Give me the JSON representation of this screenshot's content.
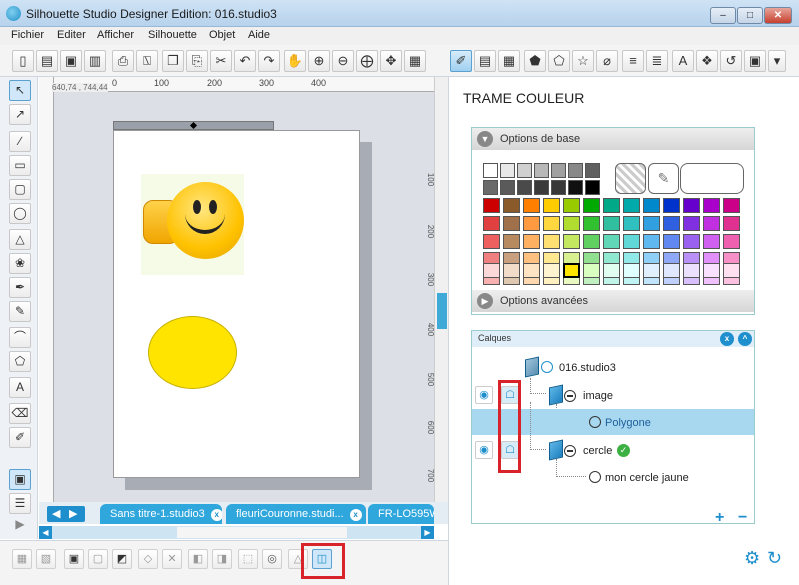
{
  "window": {
    "title": "Silhouette Studio Designer Edition: 016.studio3",
    "minimize": "–",
    "maximize": "□",
    "close": "✕"
  },
  "menu": [
    "Fichier",
    "Editer",
    "Afficher",
    "Silhouette",
    "Objet",
    "Aide"
  ],
  "toolbar": {
    "left_icons": [
      "new-doc-icon",
      "open-folder-icon",
      "save-icon",
      "save-as-icon",
      "print-icon",
      "cut-settings-icon",
      "copy-icon",
      "paste-icon",
      "scissors-icon",
      "undo-icon",
      "redo-icon",
      "pan-hand-icon",
      "zoom-in-icon",
      "zoom-out-icon",
      "zoom-select-icon",
      "zoom-drag-icon",
      "fit-page-icon"
    ],
    "left_glyphs": [
      "▯",
      "▤",
      "▣",
      "▥",
      "⎙",
      "⍂",
      "❐",
      "⎘",
      "✂",
      "↶",
      "↷",
      "✋",
      "⊕",
      "⊖",
      "⨁",
      "✥",
      "▦"
    ],
    "right_glyphs": [
      "✐",
      "▤",
      "▦",
      "⬟",
      "⬠",
      "☆",
      "⌀",
      "≡",
      "≣",
      "A",
      "❖",
      "↺",
      "▣",
      "▾"
    ]
  },
  "left_tools": [
    "↖",
    "↗",
    "∕",
    "▭",
    "▢",
    "◯",
    "△",
    "❀",
    "✒",
    "✎",
    "⌒",
    "⬠",
    "A",
    "⌫",
    "✐",
    "▣",
    "☰",
    "▶"
  ],
  "canvas": {
    "coordinates": "640,74 , 744,44",
    "ruler_top": [
      "0",
      "100",
      "200",
      "300",
      "400"
    ],
    "ruler_side": [
      "100",
      "200",
      "300",
      "400",
      "500",
      "600",
      "700"
    ]
  },
  "tabs": [
    {
      "label": "Sans titre-1.studio3",
      "close": "x"
    },
    {
      "label": "fleuriCouronne.studi...",
      "close": "x"
    },
    {
      "label": "FR-LO595W",
      "close": ""
    }
  ],
  "tab_nav": {
    "prev": "◀",
    "next": "▶"
  },
  "bottom_icons": [
    "group-icon",
    "ungroup-icon",
    "compound-icon",
    "release-compound-icon",
    "weld-icon",
    "delete-icon",
    "bring-front-icon",
    "send-back-icon",
    "offset-icon",
    "trace-icon",
    "replicate-icon",
    "layers-icon"
  ],
  "panel": {
    "title": "TRAME COULEUR",
    "basic_options": "Options de base",
    "advanced_options": "Options avancées",
    "collapse_glyph": "▼",
    "expand_glyph": "▶"
  },
  "palette": {
    "grays": [
      "#ffffff",
      "#e8e8e8",
      "#d0d0d0",
      "#b8b8b8",
      "#a0a0a0",
      "#888888",
      "#606060",
      "#383838",
      "#101010",
      "#000000"
    ],
    "rows": [
      [
        "#cc0000",
        "#8b5a2b",
        "#ff8000",
        "#ffcc00",
        "#99cc00",
        "#00aa00",
        "#00aa88",
        "#00aaaa",
        "#0088cc",
        "#0033cc",
        "#6600cc",
        "#aa00cc",
        "#cc0088"
      ],
      [
        "#e04040",
        "#a0704a",
        "#ff9a40",
        "#ffd840",
        "#b0dd30",
        "#30c030",
        "#30c0a0",
        "#30c0c0",
        "#30a0e0",
        "#3060e0",
        "#8030e0",
        "#c030e0",
        "#e03090"
      ],
      [
        "#ee6060",
        "#b88a60",
        "#ffb060",
        "#ffe070",
        "#c4e860",
        "#60d060",
        "#60d8b8",
        "#60d8d8",
        "#60b8f0",
        "#6088f0",
        "#9a60f0",
        "#d060f0",
        "#f060b0"
      ],
      [
        "#f08080",
        "#c8a080",
        "#ffc080",
        "#ffe890",
        "#d8f090",
        "#90e090",
        "#90e8d0",
        "#90e8e8",
        "#90d0f8",
        "#90a8f8",
        "#b890f8",
        "#e090f8",
        "#f890c8"
      ],
      [
        "#f8b0b0",
        "#e0c8b0",
        "#ffd8b0",
        "#fff0c0",
        "#e8f8c0",
        "#c0f0c0",
        "#c0f4e8",
        "#c0f4f4",
        "#c0e4fc",
        "#c0d0fc",
        "#d8c0fc",
        "#f0c0fc",
        "#fcc0e0"
      ]
    ],
    "selected_color": "#ffe400",
    "picker_glyph": "✎"
  },
  "layers": {
    "header": "Calques",
    "close_glyph": "x",
    "up_glyph": "^",
    "root": "016.studio3",
    "items": [
      {
        "label": "image",
        "eye": "◉",
        "lock": "☖"
      },
      {
        "label": "Polygone"
      },
      {
        "label": "cercle",
        "eye": "◉",
        "lock": "☖",
        "check": "✓"
      },
      {
        "label": "mon cercle jaune"
      }
    ],
    "add": "+",
    "remove": "−"
  },
  "footer": {
    "gear": "⚙",
    "refresh": "↻"
  },
  "colors": {
    "accent": "#1e8fcc",
    "highlight_red": "#d8232a",
    "ellipse_fill": "#ffe400",
    "selected_layer": "#a8d8f0"
  }
}
